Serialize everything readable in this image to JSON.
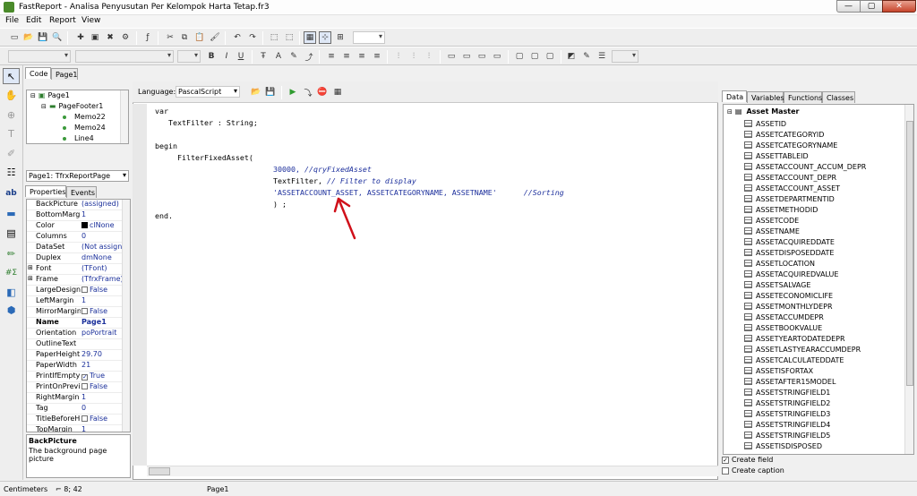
{
  "window": {
    "app_name": "FastReport",
    "title": "FastReport - Analisa Penyusutan Per Kelompok Harta Tetap.fr3",
    "min_label": "—",
    "max_label": "▢",
    "close_label": "✕"
  },
  "menu": {
    "items": [
      "File",
      "Edit",
      "Report",
      "View"
    ]
  },
  "left_panel": {
    "tabs": [
      "Code",
      "Page1"
    ],
    "tree": {
      "root": "Page1",
      "child": "PageFooter1",
      "leaves": [
        "Memo22",
        "Memo24",
        "Line4"
      ]
    },
    "page_combo": "Page1: TfrxReportPage",
    "prop_tabs": [
      "Properties",
      "Events"
    ],
    "properties": [
      {
        "name": "BackPicture",
        "value": "(assigned)"
      },
      {
        "name": "BottomMargin",
        "value": "1"
      },
      {
        "name": "Color",
        "value": "clNone"
      },
      {
        "name": "Columns",
        "value": "0"
      },
      {
        "name": "DataSet",
        "value": "(Not assigned)"
      },
      {
        "name": "Duplex",
        "value": "dmNone"
      },
      {
        "name": "Font",
        "value": "(TFont)"
      },
      {
        "name": "Frame",
        "value": "(TfrxFrame)"
      },
      {
        "name": "LargeDesignHeight",
        "value": "False"
      },
      {
        "name": "LeftMargin",
        "value": "1"
      },
      {
        "name": "MirrorMargins",
        "value": "False"
      },
      {
        "name": "Name",
        "value": "Page1"
      },
      {
        "name": "Orientation",
        "value": "poPortrait"
      },
      {
        "name": "OutlineText",
        "value": ""
      },
      {
        "name": "PaperHeight",
        "value": "29.70"
      },
      {
        "name": "PaperWidth",
        "value": "21"
      },
      {
        "name": "PrintIfEmpty",
        "value": "True"
      },
      {
        "name": "PrintOnPreviousPage",
        "value": "False"
      },
      {
        "name": "RightMargin",
        "value": "1"
      },
      {
        "name": "Tag",
        "value": "0"
      },
      {
        "name": "TitleBeforeHeader",
        "value": "False"
      },
      {
        "name": "TopMargin",
        "value": "1"
      }
    ],
    "desc_title": "BackPicture",
    "desc_text": "The background page picture"
  },
  "editor": {
    "language_label": "Language:",
    "language": "PascalScript",
    "code": {
      "l1": "var",
      "l2": "   TextFilter : String;",
      "l3": "begin",
      "l4": "     FilterFixedAsset(",
      "l5_num": "30000,",
      "l5_cmt": " //qryFixedAsset",
      "l6_txt": "TextFilter,",
      "l6_cmt": " // Filter to display",
      "l7_str": "'ASSETACCOUNT_ASSET, ASSETCATEGORYNAME, ASSETNAME'",
      "l7_cmt": "//Sorting",
      "l8": ") ;",
      "l9": "end."
    }
  },
  "right_panel": {
    "tabs": [
      "Data",
      "Variables",
      "Functions",
      "Classes"
    ],
    "dataset": "Asset Master",
    "fields": [
      "ASSETID",
      "ASSETCATEGORYID",
      "ASSETCATEGORYNAME",
      "ASSETTABLEID",
      "ASSETACCOUNT_ACCUM_DEPR",
      "ASSETACCOUNT_DEPR",
      "ASSETACCOUNT_ASSET",
      "ASSETDEPARTMENTID",
      "ASSETMETHODID",
      "ASSETCODE",
      "ASSETNAME",
      "ASSETACQUIREDDATE",
      "ASSETDISPOSEDDATE",
      "ASSETLOCATION",
      "ASSETACQUIREDVALUE",
      "ASSETSALVAGE",
      "ASSETECONOMICLIFE",
      "ASSETMONTHLYDEPR",
      "ASSETACCUMDEPR",
      "ASSETBOOKVALUE",
      "ASSETYEARTODATEDEPR",
      "ASSETLASTYEARACCUMDEPR",
      "ASSETCALCULATEDDATE",
      "ASSETISFORTAX",
      "ASSETAFTER15MODEL",
      "ASSETSTRINGFIELD1",
      "ASSETSTRINGFIELD2",
      "ASSETSTRINGFIELD3",
      "ASSETSTRINGFIELD4",
      "ASSETSTRINGFIELD5",
      "ASSETISDISPOSED"
    ],
    "create_field": "Create field",
    "create_field_checked": true,
    "create_caption": "Create caption",
    "create_caption_checked": false
  },
  "status": {
    "units": "Centimeters",
    "position": "8; 42",
    "page": "Page1"
  },
  "colors": {
    "annotation": "#d0101a",
    "code_blue": "#1c2f9c",
    "run_green": "#2f9b2f",
    "stop_red": "#d61c1c"
  }
}
